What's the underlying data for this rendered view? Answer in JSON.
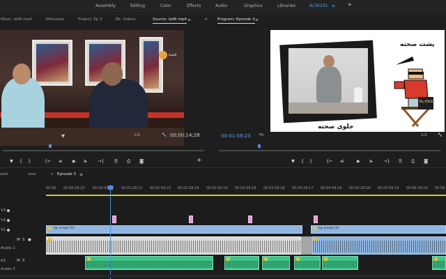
{
  "workspace": {
    "tabs": [
      {
        "label": "Assembly"
      },
      {
        "label": "Editing"
      },
      {
        "label": "Color"
      },
      {
        "label": "Effects"
      },
      {
        "label": "Audio"
      },
      {
        "label": "Graphics"
      },
      {
        "label": "Libraries"
      },
      {
        "label": "Ac3b101"
      }
    ],
    "more_glyph": "»",
    "menu_glyph": "≡"
  },
  "source_panel": {
    "tabs": [
      {
        "label": "Mixer: lat8l.mp4"
      },
      {
        "label": "Metadata"
      },
      {
        "label": "Project: Ep 3"
      },
      {
        "label": "Bk: Videos"
      },
      {
        "label": "Source: lat8l.mp4"
      }
    ],
    "overflow": "»",
    "video_logo_text": "خنده",
    "fit": "1/2",
    "timecode": "00;00;14;28",
    "wrench_glyph": "🔧"
  },
  "program_panel": {
    "title": "Program: Episode 3",
    "timecode": "00:01:08:23",
    "fit": "Fit",
    "resolution": "1/2",
    "wrench_glyph": "🔧",
    "video_text_top": "پشت صحنه",
    "video_text_bottom": "جلوی صحنه",
    "video_chair_text": "My VOICE"
  },
  "transport": {
    "mark_in": "{",
    "mark_out": "}",
    "go_in": "{←",
    "step_back": "◂I",
    "play": "▶",
    "step_fwd": "I▸",
    "go_out": "→}",
    "insert": "⎘",
    "overwrite": "⎙",
    "export_frame": "◙",
    "add": "+",
    "marker": "▼"
  },
  "timeline": {
    "tabs": [
      {
        "label": "aeld"
      },
      {
        "label": "stee"
      },
      {
        "label": "Episode 3"
      }
    ],
    "ruler_labels": [
      "00:00",
      "00:00:29:23",
      "00:00:59:22",
      "00:01:29:21",
      "00:01:59:21",
      "00:02:29:20",
      "00:02:59:19",
      "00:03:29:18",
      "00:03:59:18",
      "00:04:29:17",
      "00:04:59:16",
      "00:05:29:16",
      "00:05:59:15",
      "00:06:29:14",
      "00:06"
    ],
    "tracks": [
      {
        "label": "V3"
      },
      {
        "label": "V2"
      },
      {
        "label": "V1"
      },
      {
        "label": "Audio 1"
      },
      {
        "label": "A2"
      },
      {
        "label": "Audio 2"
      }
    ],
    "clips": {
      "v1a": "Ep 3.mp4 [V]",
      "v1b": "Ep 3.mp4 [V]",
      "fx": "fx"
    }
  }
}
